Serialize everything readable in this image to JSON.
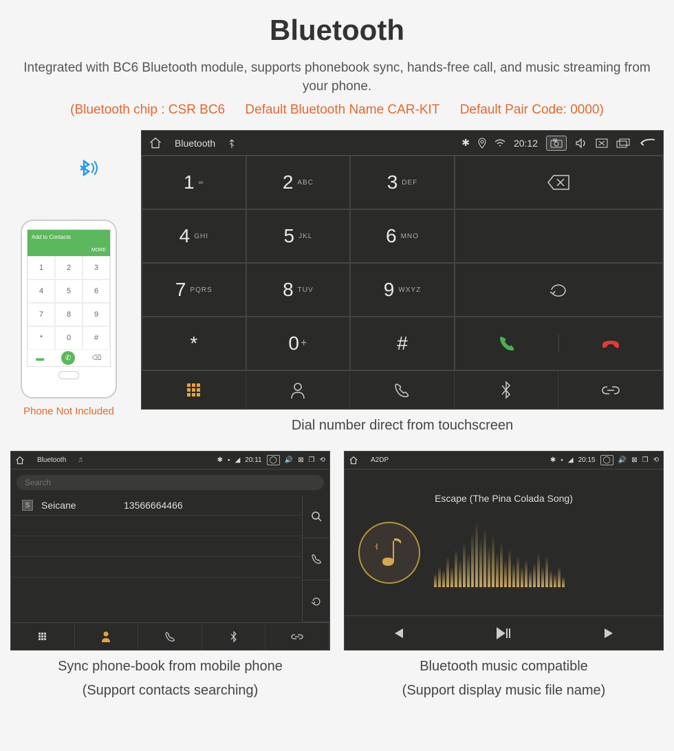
{
  "title": "Bluetooth",
  "subtitle": "Integrated with BC6 Bluetooth module, supports phonebook sync, hands-free call, and music streaming from your phone.",
  "specs": {
    "chip": "(Bluetooth chip : CSR BC6",
    "name": "Default Bluetooth Name CAR-KIT",
    "pair": "Default Pair Code: 0000)"
  },
  "phone": {
    "not_included": "Phone Not Included",
    "add_contacts": "Add to Contacts",
    "more": "MORE"
  },
  "main": {
    "status": {
      "title": "Bluetooth",
      "time": "20:12"
    },
    "keys": [
      {
        "num": "1",
        "sub": "∞"
      },
      {
        "num": "2",
        "sub": "ABC"
      },
      {
        "num": "3",
        "sub": "DEF"
      },
      {
        "num": "4",
        "sub": "GHI"
      },
      {
        "num": "5",
        "sub": "JKL"
      },
      {
        "num": "6",
        "sub": "MNO"
      },
      {
        "num": "7",
        "sub": "PQRS"
      },
      {
        "num": "8",
        "sub": "TUV"
      },
      {
        "num": "9",
        "sub": "WXYZ"
      },
      {
        "num": "*",
        "sub": ""
      },
      {
        "num": "0",
        "sub": "+"
      },
      {
        "num": "#",
        "sub": ""
      }
    ],
    "caption": "Dial number direct from touchscreen"
  },
  "phonebook": {
    "status": {
      "title": "Bluetooth",
      "time": "20:11"
    },
    "search": "Search",
    "contact": {
      "badge": "S",
      "name": "Seicane",
      "number": "13566664466"
    },
    "caption1": "Sync phone-book from mobile phone",
    "caption2": "(Support contacts searching)"
  },
  "music": {
    "status": {
      "title": "A2DP",
      "time": "20:15"
    },
    "song": "Escape (The Pina Colada Song)",
    "caption1": "Bluetooth music compatible",
    "caption2": "(Support display music file name)"
  }
}
